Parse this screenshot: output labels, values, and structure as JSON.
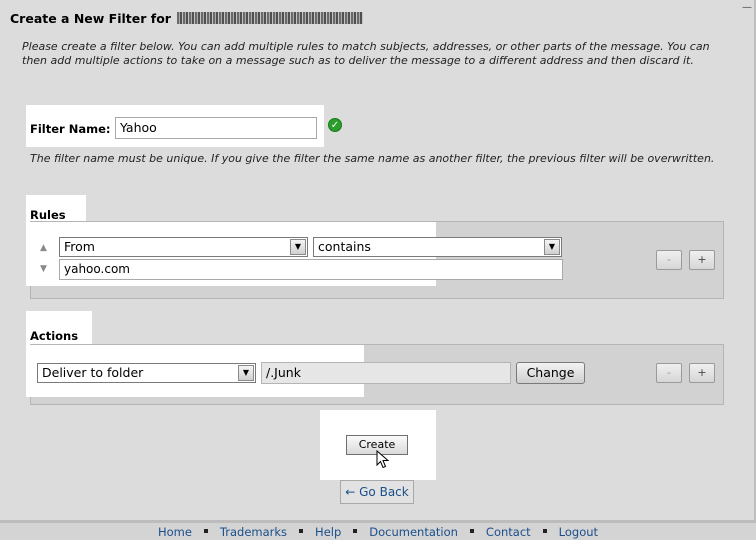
{
  "header": {
    "title": "Create a New Filter for",
    "scroll_glyph": "—"
  },
  "intro_text": "Please create a filter below. You can add multiple rules to match subjects, addresses, or other parts of the message. You can then add multiple actions to take on a message such as to deliver the message to a different address and then discard it.",
  "filter_name": {
    "label": "Filter Name:",
    "value": "Yahoo",
    "valid_icon": "check-circle-icon",
    "note": "The filter name must be unique. If you give the filter the same name as another filter, the previous filter will be overwritten."
  },
  "rules": {
    "heading": "Rules",
    "field_select": "From",
    "operator_select": "contains",
    "match_value": "yahoo.com",
    "remove_label": "-",
    "add_label": "+"
  },
  "actions": {
    "heading": "Actions",
    "action_select": "Deliver to folder",
    "destination_value": "/.Junk",
    "change_label": "Change",
    "remove_label": "-",
    "add_label": "+"
  },
  "buttons": {
    "create_label": "Create",
    "back_label": "← Go Back"
  },
  "footer": {
    "links": [
      "Home",
      "Trademarks",
      "Help",
      "Documentation",
      "Contact",
      "Logout"
    ]
  },
  "colors": {
    "background": "#dcdcdc",
    "link": "#1a4f8b",
    "valid": "#2a9d2a"
  }
}
